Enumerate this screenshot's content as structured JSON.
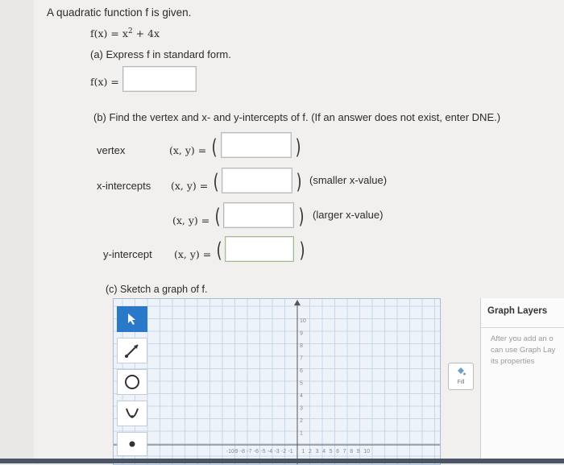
{
  "problem": {
    "intro": "A quadratic function f is given.",
    "function_lhs": "f(x) =",
    "function_rhs_base": "x",
    "function_rhs_exp": "2",
    "function_rhs_tail": " + 4x"
  },
  "part_a": {
    "label": "(a) Express f in standard form.",
    "answer_label": "f(x) =",
    "answer_value": ""
  },
  "part_b": {
    "label": "(b) Find the vertex and x- and y-intercepts of f. (If an answer does not exist, enter DNE.)",
    "vertex_label": "vertex",
    "x_intercepts_label": "x-intercepts",
    "y_intercept_label": "y-intercept",
    "pair_label": "(x, y) =",
    "open_paren": "(",
    "close_paren": ")",
    "smaller_note": "(smaller x-value)",
    "larger_note": "(larger x-value)",
    "vertex_value": "",
    "x_int_small_value": "",
    "x_int_large_value": "",
    "y_int_value": ""
  },
  "part_c": {
    "label": "(c) Sketch a graph of f."
  },
  "graph": {
    "y_ticks": [
      "10",
      "9",
      "8",
      "7",
      "6",
      "5",
      "4",
      "3",
      "2",
      "1"
    ],
    "x_ticks": [
      "-10",
      "-9",
      "-8",
      "-7",
      "-6",
      "-5",
      "-4",
      "-3",
      "-2",
      "-1",
      "1",
      "2",
      "3",
      "4",
      "5",
      "6",
      "7",
      "8",
      "9",
      "10"
    ],
    "fill_label": "Fill"
  },
  "layers_panel": {
    "title": "Graph Layers",
    "help_line1": "After you add an o",
    "help_line2": "can use Graph Lay",
    "help_line3": "its properties"
  },
  "colors": {
    "accent": "#2a78c8",
    "grid_line": "#bcd0e6"
  }
}
